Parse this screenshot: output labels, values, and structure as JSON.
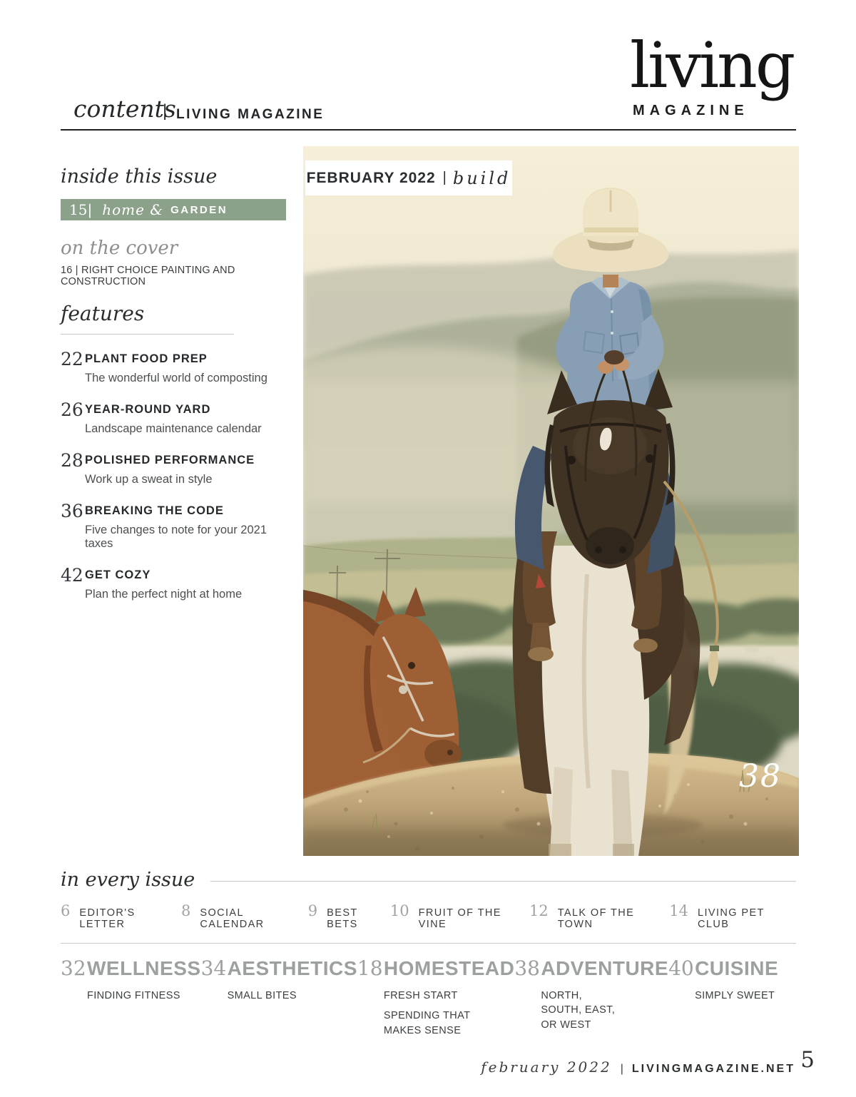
{
  "header": {
    "contents_label": "contents",
    "divider": "|",
    "magazine_label": "LIVING MAGAZINE"
  },
  "logo": {
    "word": "living",
    "sub": "MAGAZINE"
  },
  "accent_green": "#8BA189",
  "sidebar": {
    "inside_title": "inside this issue",
    "banner": {
      "number": "15|",
      "script_word": "home &",
      "bold_word": "GARDEN"
    },
    "cover_title": "on the cover",
    "cover_line": "16 | RIGHT CHOICE PAINTING AND CONSTRUCTION",
    "features_title": "features",
    "features": [
      {
        "page": "22",
        "title": "PLANT FOOD PREP",
        "desc": "The wonderful world of composting"
      },
      {
        "page": "26",
        "title": "YEAR-ROUND YARD",
        "desc": "Landscape maintenance calendar"
      },
      {
        "page": "28",
        "title": "POLISHED PERFORMANCE",
        "desc": "Work up a sweat in style"
      },
      {
        "page": "36",
        "title": "BREAKING THE CODE",
        "desc": "Five changes to note for your 2021 taxes"
      },
      {
        "page": "42",
        "title": "GET COZY",
        "desc": "Plan the perfect night at home"
      }
    ]
  },
  "photo": {
    "label": {
      "month": "FEBRUARY 2022",
      "sep": "|",
      "word": "build"
    },
    "page_ref": "38"
  },
  "every_issue": {
    "title": "in every issue",
    "items": [
      {
        "page": "6",
        "label": "EDITOR'S LETTER"
      },
      {
        "page": "8",
        "label": "SOCIAL CALENDAR"
      },
      {
        "page": "9",
        "label": "BEST BETS"
      },
      {
        "page": "10",
        "label": "FRUIT OF THE VINE"
      },
      {
        "page": "12",
        "label": "TALK OF THE TOWN"
      },
      {
        "page": "14",
        "label": "LIVING PET CLUB"
      }
    ],
    "sections": [
      {
        "page": "32",
        "label": "WELLNESS",
        "subs": [
          "FINDING FITNESS"
        ]
      },
      {
        "page": "34",
        "label": "AESTHETICS",
        "subs": [
          "SMALL BITES"
        ]
      },
      {
        "page": "18",
        "label": "HOMESTEAD",
        "subs": [
          "FRESH START",
          "SPENDING THAT MAKES SENSE"
        ]
      },
      {
        "page": "38",
        "label": "ADVENTURE",
        "subs": [
          "NORTH, SOUTH, EAST, OR WEST"
        ]
      },
      {
        "page": "40",
        "label": "CUISINE",
        "subs": [
          "SIMPLY SWEET"
        ]
      }
    ]
  },
  "footer": {
    "issue": "february 2022",
    "sep": "|",
    "site": "LIVINGMAGAZINE.NET",
    "page_number": "5"
  }
}
